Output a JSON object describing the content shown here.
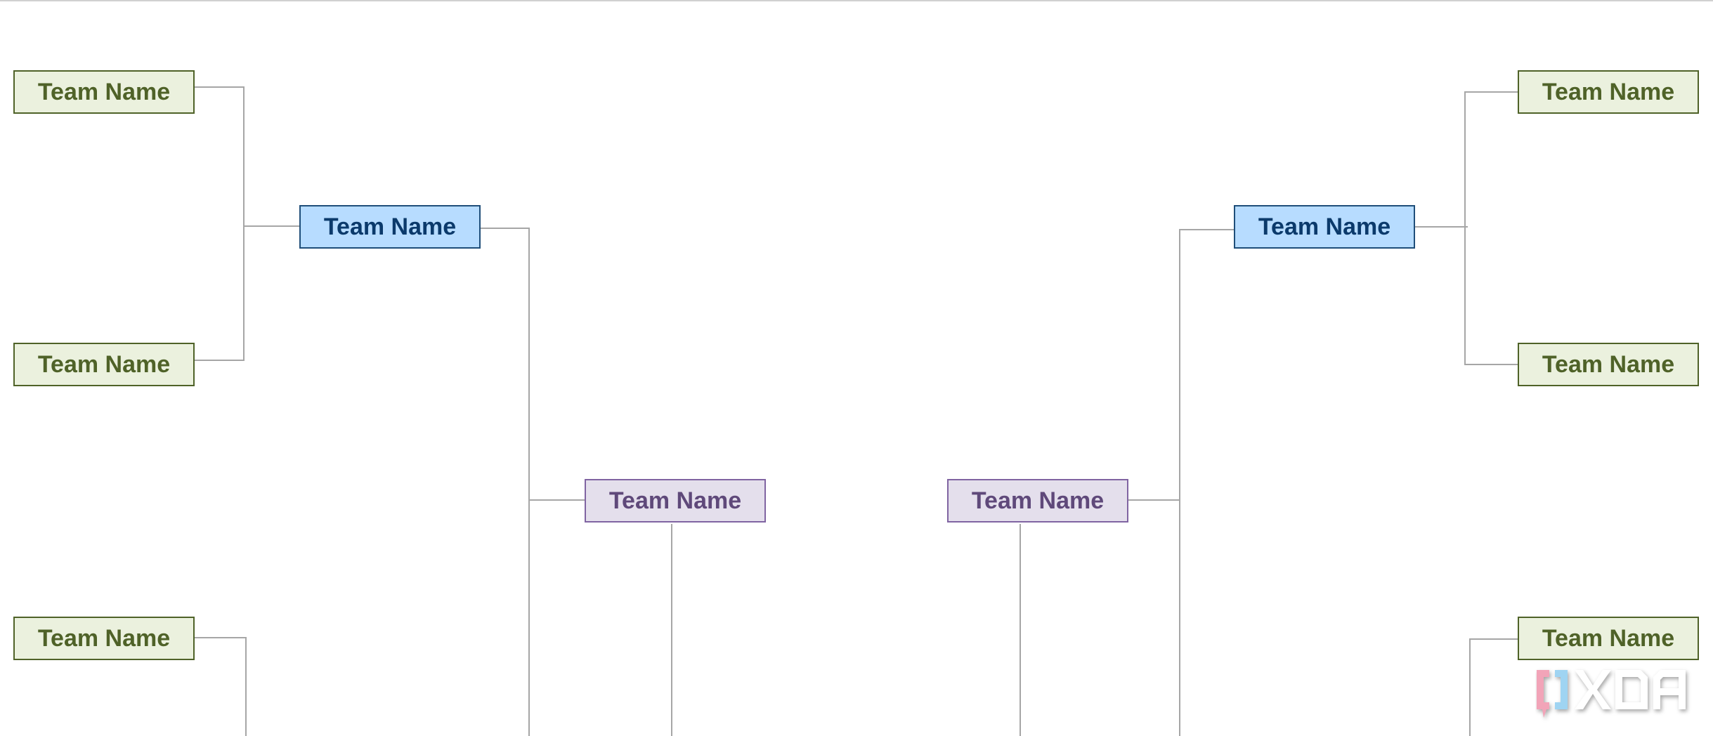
{
  "bracket": {
    "left": {
      "round1": [
        {
          "label": "Team Name"
        },
        {
          "label": "Team Name"
        },
        {
          "label": "Team Name"
        }
      ],
      "round2": [
        {
          "label": "Team Name"
        }
      ],
      "round3": [
        {
          "label": "Team Name"
        }
      ]
    },
    "right": {
      "round1": [
        {
          "label": "Team Name"
        },
        {
          "label": "Team Name"
        },
        {
          "label": "Team Name"
        }
      ],
      "round2": [
        {
          "label": "Team Name"
        }
      ],
      "round3": [
        {
          "label": "Team Name"
        }
      ]
    }
  },
  "colors": {
    "round1_fill": "#ebf1de",
    "round1_text": "#4f6228",
    "round2_fill": "#b7dcff",
    "round2_text": "#0b3a6b",
    "round3_fill": "#e4dfec",
    "round3_text": "#5f497a",
    "connector": "#a6a6a6"
  },
  "watermark": {
    "text": "XDA"
  }
}
